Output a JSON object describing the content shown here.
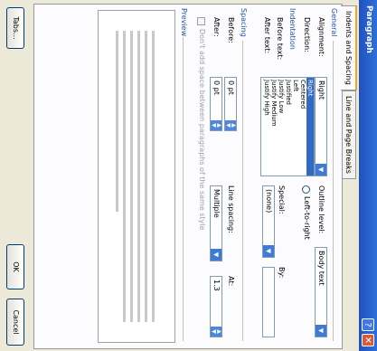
{
  "window": {
    "title": "Paragraph",
    "help_glyph": "?",
    "close_glyph": "✕"
  },
  "tabs": [
    "Indents and Spacing",
    "Line and Page Breaks"
  ],
  "general": {
    "heading": "General",
    "alignment_label": "Alignment:",
    "alignment_value": "Right",
    "alignment_options": [
      "Right",
      "Centered",
      "Left",
      "Justified",
      "Justify Low",
      "Justify Medium",
      "Justify High"
    ],
    "outline_label": "Outline level:",
    "outline_value": "Body text",
    "direction_label": "Direction:",
    "direction_option": "Left-to-right"
  },
  "indentation": {
    "heading": "Indentation",
    "before_label": "Before text:",
    "after_label": "After text:",
    "special_label": "Special:",
    "special_value": "(none)",
    "by_label": "By:"
  },
  "spacing": {
    "heading": "Spacing",
    "before_label": "Before:",
    "before_value": "0 pt",
    "after_label": "After:",
    "after_value": "0 pt",
    "line_spacing_label": "Line spacing:",
    "line_spacing_value": "Multiple",
    "at_label": "At:",
    "at_value": "1.3",
    "dont_add_space_label": "Don't add space between paragraphs of the same style"
  },
  "preview": {
    "heading": "Preview"
  },
  "buttons": {
    "tabs": "Tabs...",
    "ok": "OK",
    "cancel": "Cancel"
  },
  "icons": {
    "dropdown": "▼",
    "spin_up": "▲",
    "spin_down": "▼"
  }
}
